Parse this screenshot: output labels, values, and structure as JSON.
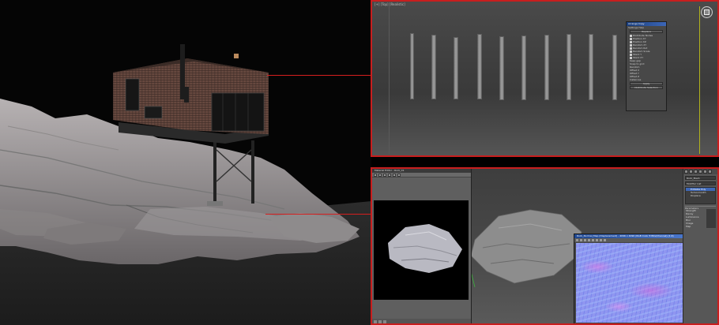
{
  "top_viewport": {
    "label": "[+] [Top] [Realistic]",
    "dialog": {
      "title": "Arrange Copy",
      "menu": "Settings  Help",
      "button_primary": "Replace",
      "rows": [
        "Distribute Nodes",
        "Position XY",
        "Position XZ",
        "Random XY",
        "Random Rot",
        "Random Scale",
        "Stack Y",
        "Stack XY"
      ],
      "options": [
        "Keep gap",
        "Snap to grid",
        "Random",
        "Offset X",
        "Offset Y",
        "Offset Z"
      ],
      "section": "Instances",
      "apply_button": "Apply",
      "footer_button": "Distribute Selection"
    }
  },
  "bottom_viewport": {
    "material_window": {
      "title": "Material Editor - Rock_01"
    },
    "normal_map_window": {
      "title": "Rock_Normal_Map (Displacement) - 4096 x 4096 (RGB Color 8 Bits/Channel) (1:4)"
    },
    "command_panel": {
      "field": "Rock_Mesh",
      "list_header": "Modifier List",
      "selected_item": "Editable Poly",
      "items": [
        "Turbosmooth",
        "Displace"
      ],
      "rollout": "Parameters",
      "props": [
        {
          "label": "Strength"
        },
        {
          "label": "Decay"
        },
        {
          "label": "Luminance"
        },
        {
          "label": "Blur"
        },
        {
          "label": "Image"
        },
        {
          "label": "Map"
        }
      ]
    }
  },
  "colors": {
    "callout": "#d51f1f",
    "viewport_border": "#c81e1e",
    "dialog_title": "#3c66b7",
    "selection": "#3e67b6"
  }
}
